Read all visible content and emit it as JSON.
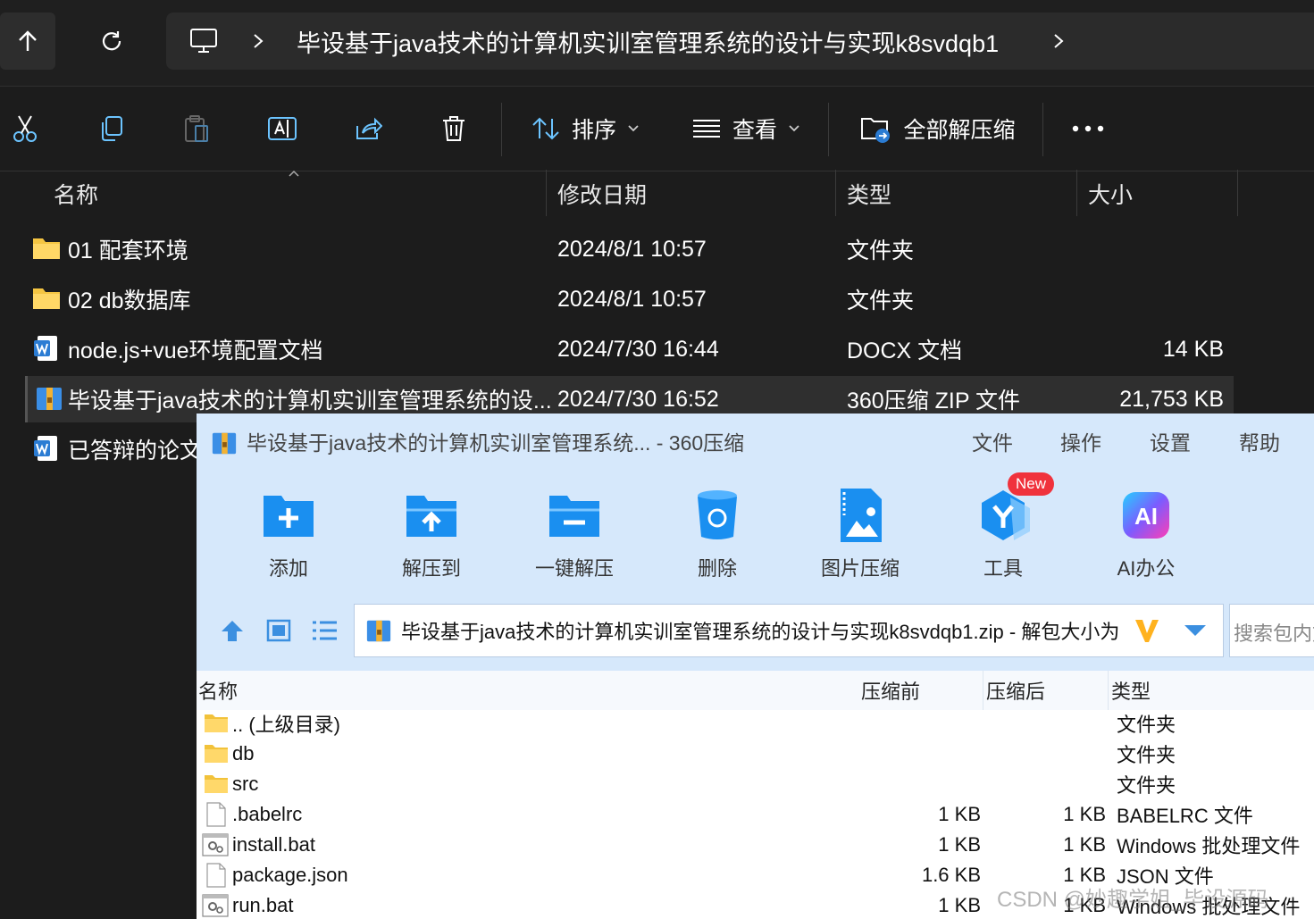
{
  "explorer": {
    "address": {
      "breadcrumb": "毕设基于java技术的计算机实训室管理系统的设计与实现k8svdqb1"
    },
    "toolbar": {
      "sort_label": "排序",
      "view_label": "查看",
      "extract_all_label": "全部解压缩"
    },
    "columns": {
      "name": "名称",
      "date": "修改日期",
      "type": "类型",
      "size": "大小"
    },
    "files": [
      {
        "name": "01 配套环境",
        "date": "2024/8/1 10:57",
        "type": "文件夹",
        "size": "",
        "icon": "folder-icon"
      },
      {
        "name": "02 db数据库",
        "date": "2024/8/1 10:57",
        "type": "文件夹",
        "size": "",
        "icon": "folder-icon"
      },
      {
        "name": "node.js+vue环境配置文档",
        "date": "2024/7/30 16:44",
        "type": "DOCX 文档",
        "size": "14 KB",
        "icon": "word-icon"
      },
      {
        "name": "毕设基于java技术的计算机实训室管理系统的设...",
        "date": "2024/7/30 16:52",
        "type": "360压缩 ZIP 文件",
        "size": "21,753 KB",
        "icon": "zip-icon",
        "selected": true
      },
      {
        "name": "已答辩的论文",
        "date": "",
        "type": "",
        "size": "",
        "icon": "word-icon"
      }
    ]
  },
  "zipwin": {
    "title": "毕设基于java技术的计算机实训室管理系统... - 360压缩",
    "menus": [
      "文件",
      "操作",
      "设置",
      "帮助"
    ],
    "tools": [
      {
        "label": "添加",
        "icon": "add-folder-icon"
      },
      {
        "label": "解压到",
        "icon": "extract-to-icon"
      },
      {
        "label": "一键解压",
        "icon": "one-click-extract-icon"
      },
      {
        "label": "删除",
        "icon": "delete-icon"
      },
      {
        "label": "图片压缩",
        "icon": "image-compress-icon"
      },
      {
        "label": "工具",
        "icon": "tools-icon",
        "badge": "New"
      },
      {
        "label": "AI办公",
        "icon": "ai-office-icon"
      }
    ],
    "path": "毕设基于java技术的计算机实训室管理系统的设计与实现k8svdqb1.zip - 解包大小为",
    "search_placeholder": "搜索包内文件",
    "list_columns": {
      "name": "名称",
      "before": "压缩前",
      "after": "压缩后",
      "type": "类型"
    },
    "entries": [
      {
        "name": ".. (上级目录)",
        "before": "",
        "after": "",
        "type": "文件夹",
        "icon": "folder-icon"
      },
      {
        "name": "db",
        "before": "",
        "after": "",
        "type": "文件夹",
        "icon": "folder-icon"
      },
      {
        "name": "src",
        "before": "",
        "after": "",
        "type": "文件夹",
        "icon": "folder-icon"
      },
      {
        "name": ".babelrc",
        "before": "1 KB",
        "after": "1 KB",
        "type": "BABELRC 文件",
        "icon": "file-icon"
      },
      {
        "name": "install.bat",
        "before": "1 KB",
        "after": "1 KB",
        "type": "Windows 批处理文件",
        "icon": "bat-icon"
      },
      {
        "name": "package.json",
        "before": "1.6 KB",
        "after": "1 KB",
        "type": "JSON 文件",
        "icon": "file-icon"
      },
      {
        "name": "run.bat",
        "before": "1 KB",
        "after": "1 KB",
        "type": "Windows 批处理文件",
        "icon": "bat-icon"
      }
    ],
    "watermark": "CSDN @妙趣学姐_毕设源码"
  }
}
